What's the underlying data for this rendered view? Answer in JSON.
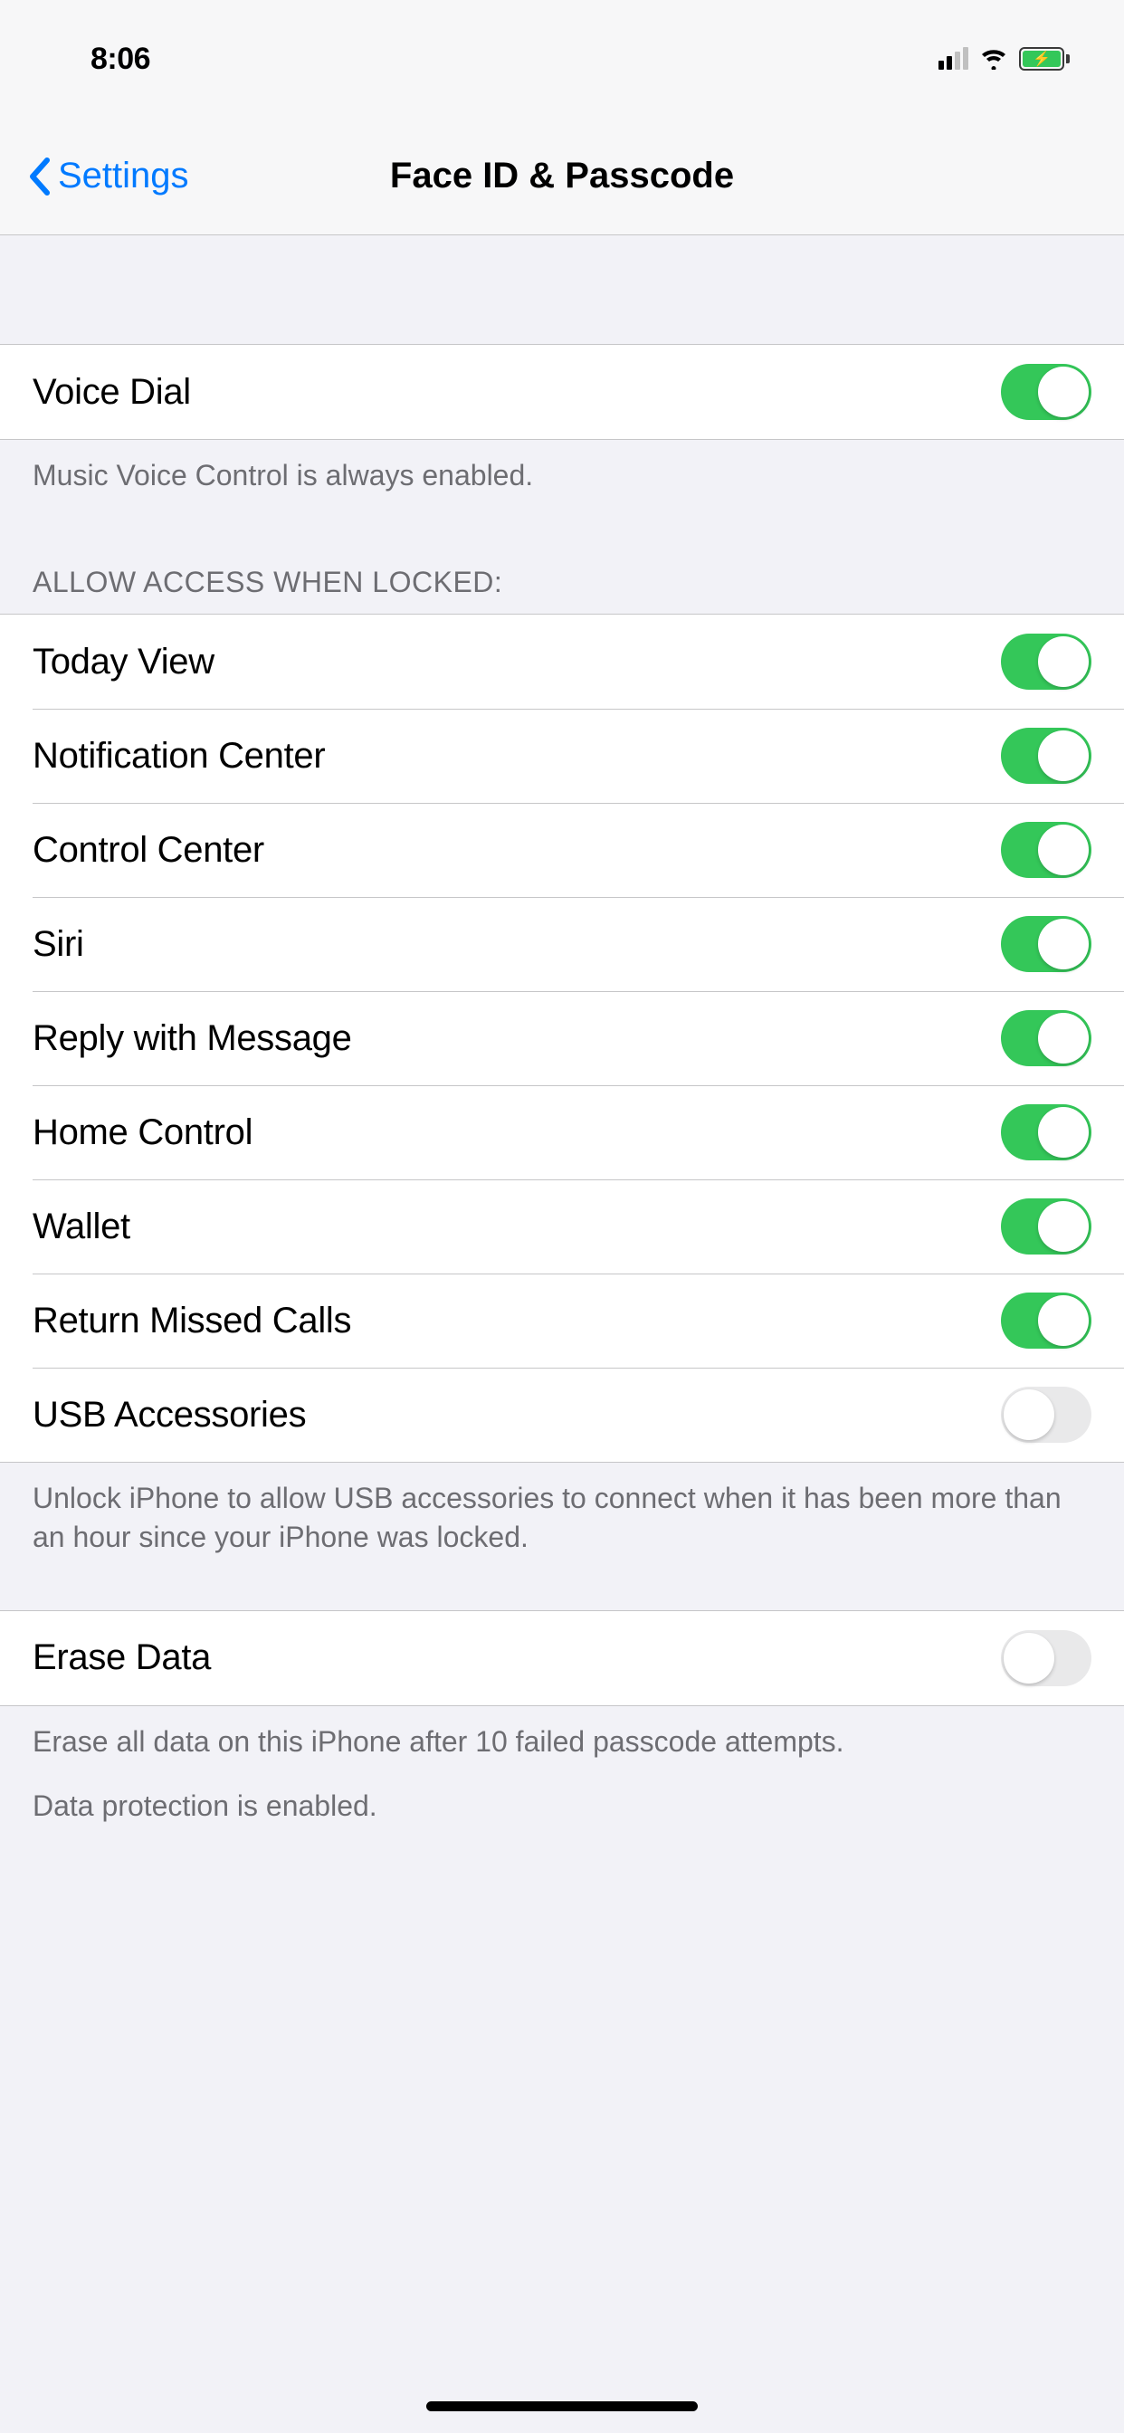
{
  "status": {
    "time": "8:06"
  },
  "nav": {
    "back_label": "Settings",
    "title": "Face ID & Passcode"
  },
  "voice_dial": {
    "label": "Voice Dial",
    "enabled": true,
    "footer": "Music Voice Control is always enabled."
  },
  "allow_access": {
    "header": "ALLOW ACCESS WHEN LOCKED:",
    "items": [
      {
        "label": "Today View",
        "enabled": true
      },
      {
        "label": "Notification Center",
        "enabled": true
      },
      {
        "label": "Control Center",
        "enabled": true
      },
      {
        "label": "Siri",
        "enabled": true
      },
      {
        "label": "Reply with Message",
        "enabled": true
      },
      {
        "label": "Home Control",
        "enabled": true
      },
      {
        "label": "Wallet",
        "enabled": true
      },
      {
        "label": "Return Missed Calls",
        "enabled": true
      },
      {
        "label": "USB Accessories",
        "enabled": false
      }
    ],
    "footer": "Unlock iPhone to allow USB accessories to connect when it has been more than an hour since your iPhone was locked."
  },
  "erase_data": {
    "label": "Erase Data",
    "enabled": false,
    "footer1": "Erase all data on this iPhone after 10 failed passcode attempts.",
    "footer2": "Data protection is enabled."
  }
}
